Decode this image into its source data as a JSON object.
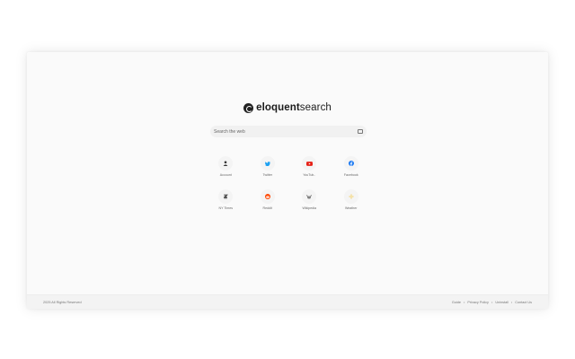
{
  "logo": {
    "bold": "eloquent",
    "light": "search"
  },
  "search": {
    "placeholder": "Search the web"
  },
  "shortcuts": [
    {
      "label": "Account",
      "icon": "person-icon",
      "color": "#333333"
    },
    {
      "label": "Twitter",
      "icon": "twitter-icon",
      "color": "#1da1f2"
    },
    {
      "label": "YouTub..",
      "icon": "youtube-icon",
      "color": "#e62117"
    },
    {
      "label": "Facebook",
      "icon": "facebook-icon",
      "color": "#1877f2"
    },
    {
      "label": "NY Times",
      "icon": "nytimes-icon",
      "color": "#222222"
    },
    {
      "label": "Reddit",
      "icon": "reddit-icon",
      "color": "#ff4500"
    },
    {
      "label": "Wikipedia",
      "icon": "wikipedia-icon",
      "color": "#444444"
    },
    {
      "label": "Weather",
      "icon": "sun-icon",
      "color": "#f5c842"
    }
  ],
  "footer": {
    "copyright": "2025 All Rights Reserved",
    "links": [
      "Guide",
      "Privacy Policy",
      "Uninstall",
      "Contact Us"
    ]
  }
}
